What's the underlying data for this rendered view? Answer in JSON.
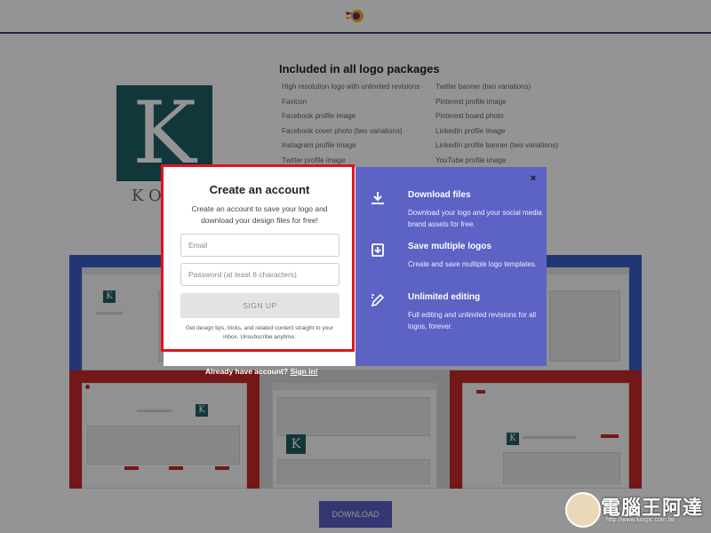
{
  "page": {
    "packages_title": "Included in all logo packages",
    "packages_left": [
      "High resolution logo with unlimited revisions",
      "Favicon",
      "Facebook profile image",
      "Facebook cover photo (two variations)",
      "Instagram profile image",
      "Twitter profile image"
    ],
    "packages_right": [
      "Twitter banner (two variations)",
      "Pinterest profile image",
      "Pinterest board photo",
      "LinkedIn profile image",
      "LinkedIn profile banner (two variations)",
      "YouTube profile image"
    ],
    "logo_letter": "K",
    "logo_word": "KO",
    "download_label": "DOWNLOAD"
  },
  "modal": {
    "title": "Create an account",
    "subtitle": "Create an account to save your logo and download your design files for free!",
    "email_placeholder": "Email",
    "password_placeholder": "Password (at least 6 characters)",
    "signup_label": "SIGN UP",
    "fine_print": "Get design tips, tricks, and related content straight to your inbox. Unsubscribe anytime.",
    "close_label": "×",
    "features": [
      {
        "icon": "download-icon",
        "title": "Download files",
        "desc": "Download your logo and your social media brand assets for free."
      },
      {
        "icon": "save-multiple-icon",
        "title": "Save multiple logos",
        "desc": "Create and save multiple logo templates."
      },
      {
        "icon": "edit-icon",
        "title": "Unlimited editing",
        "desc": "Full editing and unlimited revisions for all logos, forever."
      }
    ]
  },
  "signin": {
    "prompt": "Already have account?",
    "link_label": "Sign in!"
  },
  "watermark": {
    "text": "電腦王阿達",
    "url": "http://www.kocpc.com.tw"
  },
  "colors": {
    "accent": "#5d63c5",
    "highlight": "#e0131f",
    "brand_teal": "#1f5f66",
    "panel_blue": "#3a5fc8",
    "panel_red": "#c62828"
  }
}
